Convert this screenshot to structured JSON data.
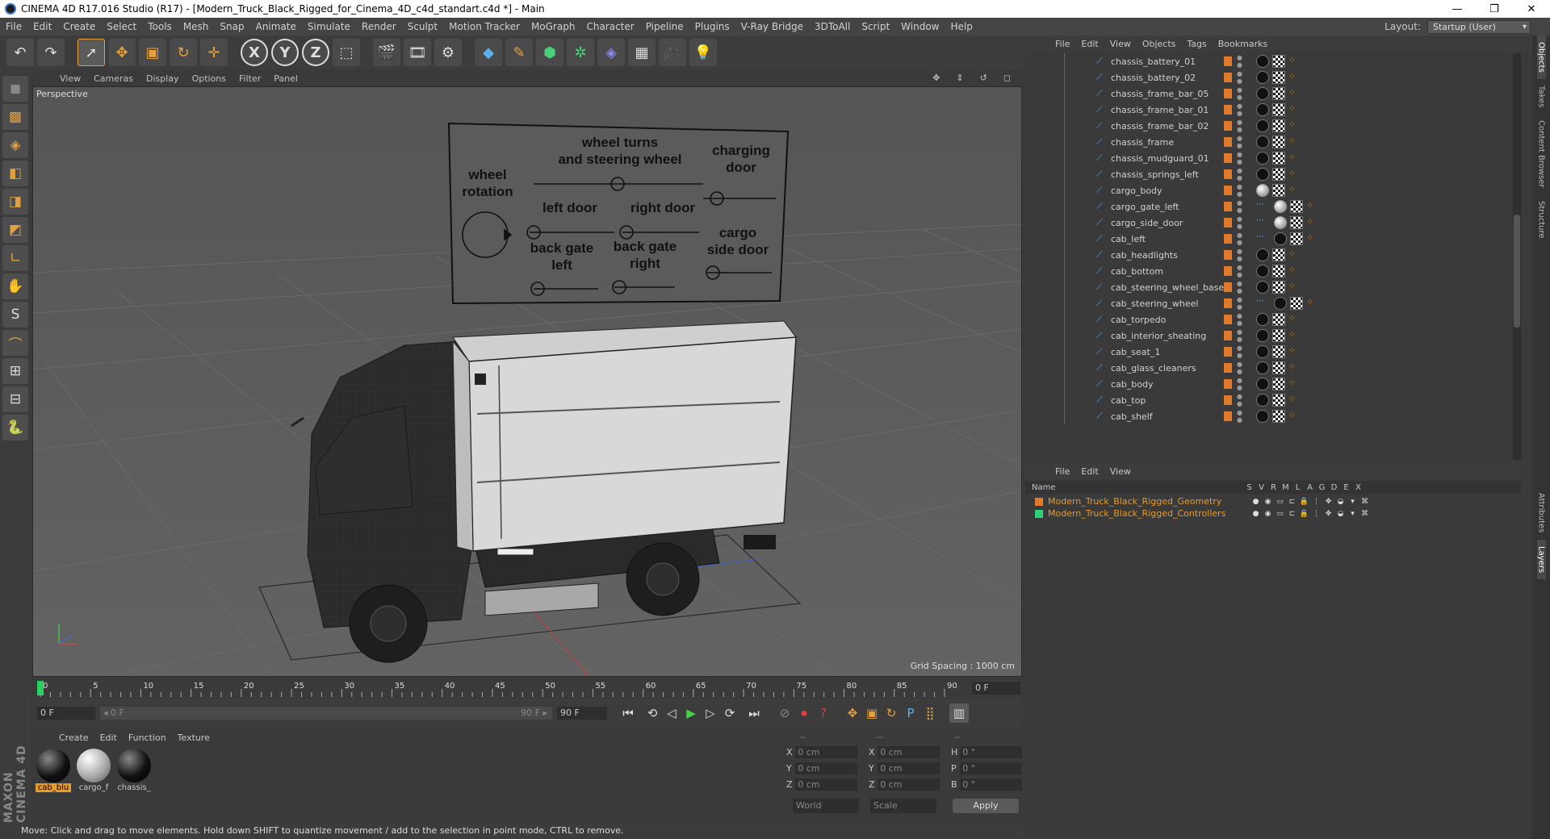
{
  "window": {
    "title": "CINEMA 4D R17.016 Studio (R17) - [Modern_Truck_Black_Rigged_for_Cinema_4D_c4d_standart.c4d *] - Main",
    "minimize": "—",
    "maximize": "❐",
    "close": "✕"
  },
  "menu": [
    "File",
    "Edit",
    "Create",
    "Select",
    "Tools",
    "Mesh",
    "Snap",
    "Animate",
    "Simulate",
    "Render",
    "Sculpt",
    "Motion Tracker",
    "MoGraph",
    "Character",
    "Pipeline",
    "Plugins",
    "V-Ray Bridge",
    "3DToAll",
    "Script",
    "Window",
    "Help"
  ],
  "layout": {
    "label": "Layout:",
    "value": "Startup (User)"
  },
  "toolbar": {
    "undo": "↶",
    "redo": "↷",
    "select": "➚",
    "move": "✥",
    "scale": "▣",
    "rotate": "↻",
    "transform": "✛",
    "axis_x": "X",
    "axis_y": "Y",
    "axis_z": "Z",
    "coord": "⬚",
    "render_view": "🎬",
    "render_pv": "🎞",
    "render_settings": "⚙",
    "cube": "◆",
    "pen": "✎",
    "subdiv": "⬢",
    "cloner": "✲",
    "deformer": "◈",
    "floor": "▦",
    "camera": "🎥",
    "light": "💡"
  },
  "lefttools": [
    "◼",
    "▩",
    "◈",
    "◧",
    "◨",
    "◩",
    "∟",
    "✋",
    "S",
    "⌒",
    "⊞",
    "⊟",
    "🐍"
  ],
  "brand": "MAXON CINEMA 4D",
  "viewport": {
    "menu": [
      "View",
      "Cameras",
      "Display",
      "Options",
      "Filter",
      "Panel"
    ],
    "nav_icons": [
      "✥",
      "⇕",
      "↺",
      "◻"
    ],
    "label": "Perspective",
    "grid_spacing": "Grid Spacing : 1000 cm",
    "board": {
      "wheel_rotation": [
        "wheel",
        "rotation"
      ],
      "wheel_turns": [
        "wheel turns",
        "and steering wheel"
      ],
      "charging_door": [
        "charging",
        "door"
      ],
      "left_door": "left door",
      "right_door": "right door",
      "back_gate_left": [
        "back gate",
        "left"
      ],
      "back_gate_right": [
        "back gate",
        "right"
      ],
      "cargo_side_door": [
        "cargo",
        "side door"
      ]
    }
  },
  "timeline": {
    "ticks": [
      "0",
      "5",
      "10",
      "15",
      "20",
      "25",
      "30",
      "35",
      "40",
      "45",
      "50",
      "55",
      "60",
      "65",
      "70",
      "75",
      "80",
      "85",
      "90"
    ],
    "frame_end": "0 F"
  },
  "transport": {
    "start": "0 F",
    "slider_start": "◂ 0 F",
    "slider_end": "90 F ▸",
    "end": "90 F",
    "buttons": [
      "⏮",
      "⟲",
      "◁",
      "▶",
      "▷",
      "⟳",
      "⏭"
    ],
    "record": [
      "⊘",
      "⏺",
      "?"
    ],
    "keys": [
      "✥",
      "▣",
      "↻",
      "P",
      "⣿"
    ],
    "timeline_btn": "▥"
  },
  "materials": {
    "menu": [
      "Create",
      "Edit",
      "Function",
      "Texture"
    ],
    "items": [
      {
        "name": "cab_blu",
        "selected": true,
        "kind": "black"
      },
      {
        "name": "cargo_f",
        "selected": false,
        "kind": "white"
      },
      {
        "name": "chassis_",
        "selected": false,
        "kind": "black"
      }
    ]
  },
  "coords": {
    "header": [
      "--",
      "--",
      "--"
    ],
    "rows": [
      {
        "a1": "X",
        "v1": "0 cm",
        "a2": "X",
        "v2": "0 cm",
        "a3": "H",
        "v3": "0 °"
      },
      {
        "a1": "Y",
        "v1": "0 cm",
        "a2": "Y",
        "v2": "0 cm",
        "a3": "P",
        "v3": "0 °"
      },
      {
        "a1": "Z",
        "v1": "0 cm",
        "a2": "Z",
        "v2": "0 cm",
        "a3": "B",
        "v3": "0 °"
      }
    ],
    "world": "World",
    "scale": "Scale",
    "apply": "Apply"
  },
  "status": "Move: Click and drag to move elements. Hold down SHIFT to quantize movement / add to the selection in point mode, CTRL to remove.",
  "objects": {
    "menu": [
      "File",
      "Edit",
      "View",
      "Objects",
      "Tags",
      "Bookmarks"
    ],
    "rows": [
      {
        "name": "chassis_battery_01",
        "tags": [
          "black",
          "chk",
          "ik"
        ]
      },
      {
        "name": "chassis_battery_02",
        "tags": [
          "black",
          "chk",
          "ik"
        ]
      },
      {
        "name": "chassis_frame_bar_05",
        "tags": [
          "black",
          "chk",
          "ik"
        ]
      },
      {
        "name": "chassis_frame_bar_01",
        "tags": [
          "black",
          "chk",
          "ik"
        ]
      },
      {
        "name": "chassis_frame_bar_02",
        "tags": [
          "black",
          "chk",
          "ik"
        ]
      },
      {
        "name": "chassis_frame",
        "tags": [
          "black",
          "chk",
          "ik"
        ]
      },
      {
        "name": "chassis_mudguard_01",
        "tags": [
          "black",
          "chk",
          "ik"
        ]
      },
      {
        "name": "chassis_springs_left",
        "tags": [
          "black",
          "chk",
          "ik"
        ]
      },
      {
        "name": "cargo_body",
        "tags": [
          "sp",
          "chk",
          "ik"
        ]
      },
      {
        "name": "cargo_gate_left",
        "tags": [
          "ctrl",
          "sp",
          "chk",
          "ik"
        ]
      },
      {
        "name": "cargo_side_door",
        "tags": [
          "ctrl",
          "sp",
          "chk",
          "ik"
        ]
      },
      {
        "name": "cab_left",
        "tags": [
          "ctrl",
          "black",
          "chk",
          "ik"
        ]
      },
      {
        "name": "cab_headlights",
        "tags": [
          "black",
          "chk",
          "ik"
        ]
      },
      {
        "name": "cab_bottom",
        "tags": [
          "black",
          "chk",
          "ik"
        ]
      },
      {
        "name": "cab_steering_wheel_base",
        "tags": [
          "black",
          "chk",
          "ik"
        ]
      },
      {
        "name": "cab_steering_wheel",
        "tags": [
          "ctrl",
          "black",
          "chk",
          "ik"
        ]
      },
      {
        "name": "cab_torpedo",
        "tags": [
          "black",
          "chk",
          "ik"
        ]
      },
      {
        "name": "cab_interior_sheating",
        "tags": [
          "black",
          "chk",
          "ik"
        ]
      },
      {
        "name": "cab_seat_1",
        "tags": [
          "black",
          "chk",
          "ik"
        ]
      },
      {
        "name": "cab_glass_cleaners",
        "tags": [
          "black",
          "chk",
          "ik"
        ]
      },
      {
        "name": "cab_body",
        "tags": [
          "black",
          "chk",
          "ik"
        ]
      },
      {
        "name": "cab_top",
        "tags": [
          "black",
          "chk",
          "ik"
        ]
      },
      {
        "name": "cab_shelf",
        "tags": [
          "black",
          "chk",
          "ik"
        ]
      }
    ]
  },
  "layers": {
    "menu": [
      "File",
      "Edit",
      "View"
    ],
    "header": {
      "name": "Name",
      "cols": [
        "S",
        "V",
        "R",
        "M",
        "L",
        "A",
        "G",
        "D",
        "E",
        "X"
      ]
    },
    "rows": [
      {
        "name": "Modern_Truck_Black_Rigged_Geometry",
        "color": "#e07a2a"
      },
      {
        "name": "Modern_Truck_Black_Rigged_Controllers",
        "color": "#2ad07a"
      }
    ],
    "icons": [
      "●",
      "◉",
      "▭",
      "⊏",
      "🔒",
      "⋮",
      "✥",
      "◒",
      "▾",
      "⌘"
    ]
  },
  "side_tabs": [
    "Objects",
    "Takes",
    "Content Browser",
    "Structure",
    "Attributes",
    "Layers"
  ]
}
